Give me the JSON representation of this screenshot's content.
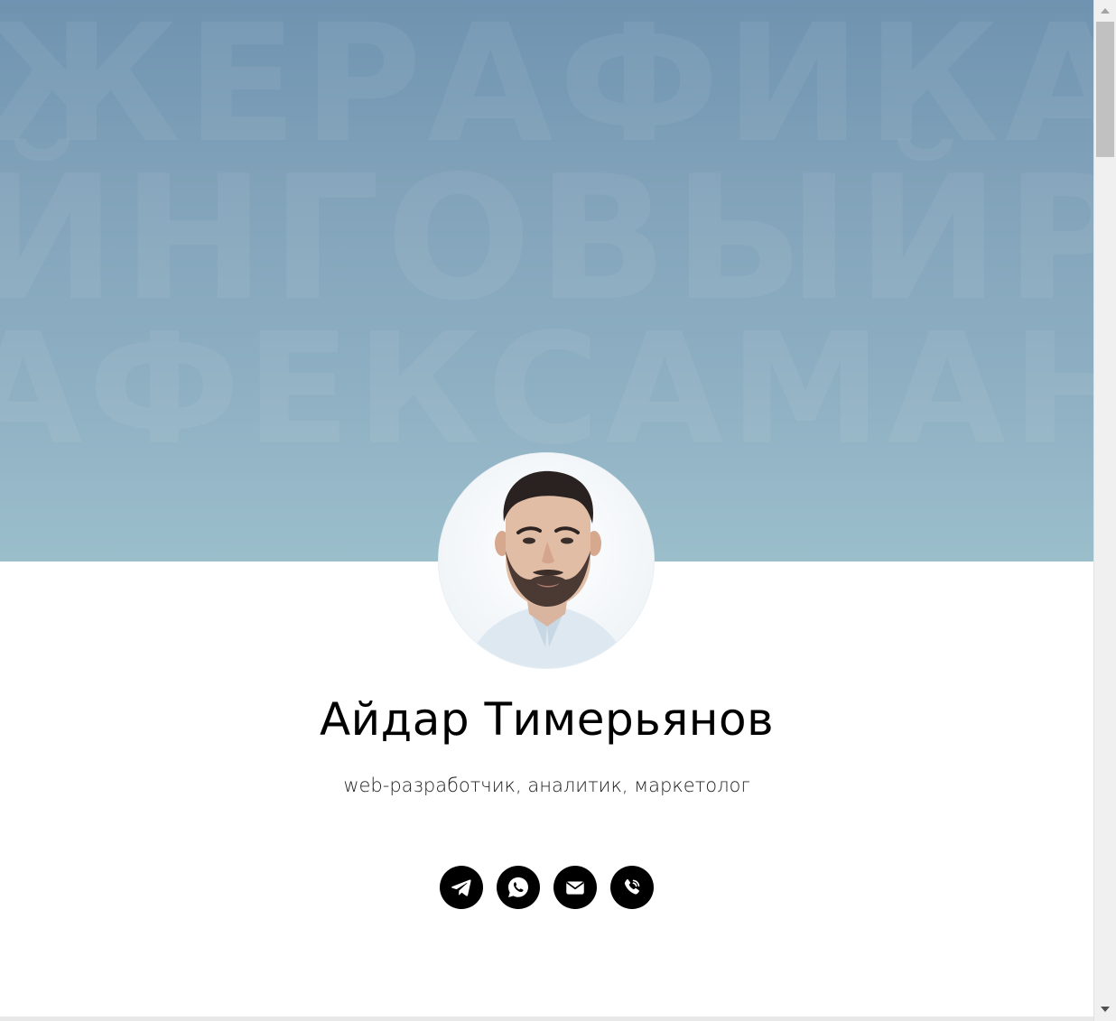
{
  "profile": {
    "name": "Айдар Тимерьянов",
    "subtitle": "web-разработчик, аналитик, маркетолог"
  },
  "hero": {
    "watermark_rows": [
      "ЖЕРАФИКАЖЕ",
      "ЙНГОВЫЙРЕ",
      "АФЕКСАМАН"
    ],
    "colors": {
      "top": "#6f93b0",
      "bottom": "#9bbecb"
    }
  },
  "socials": [
    {
      "id": "telegram",
      "icon": "telegram-icon"
    },
    {
      "id": "whatsapp",
      "icon": "whatsapp-icon"
    },
    {
      "id": "email",
      "icon": "mail-icon"
    },
    {
      "id": "viber",
      "icon": "viber-phone-icon"
    }
  ],
  "colors": {
    "accent": "#000000",
    "text": "#000000",
    "background": "#ffffff"
  }
}
